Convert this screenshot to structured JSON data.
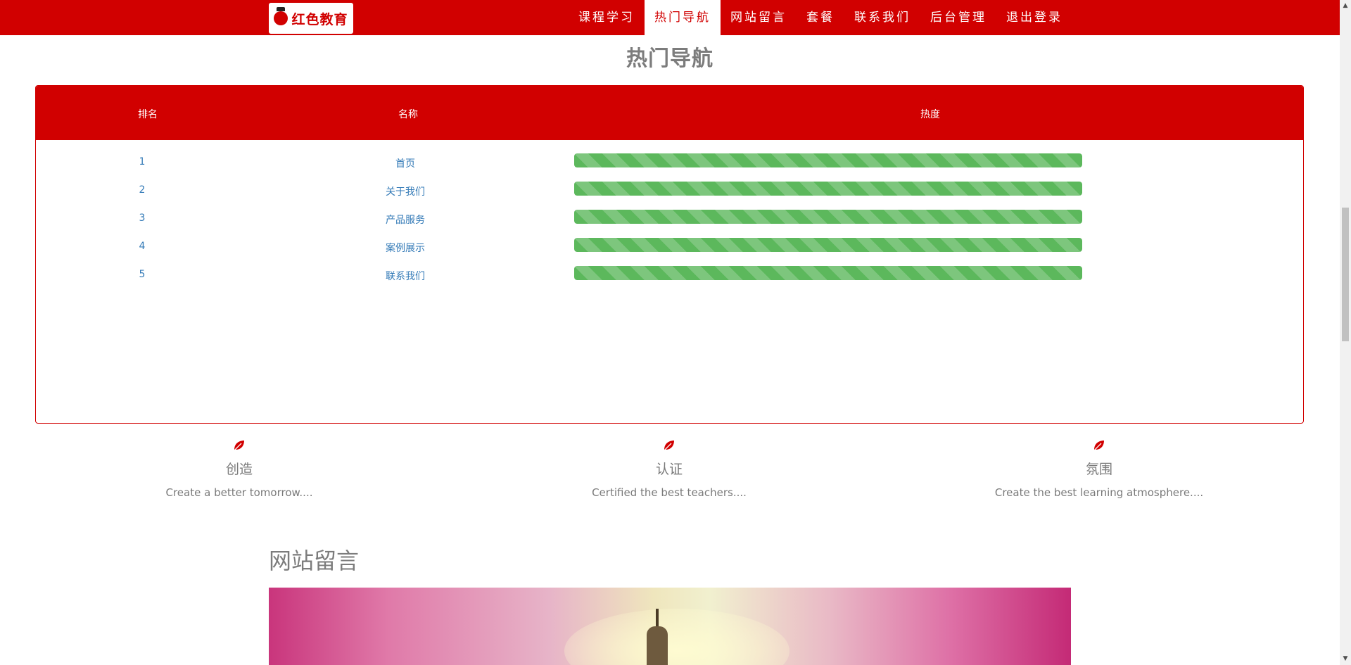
{
  "brand": {
    "logo_text": "红色教育"
  },
  "nav": {
    "items": [
      {
        "label": "课程学习",
        "active": false
      },
      {
        "label": "热门导航",
        "active": true
      },
      {
        "label": "网站留言",
        "active": false
      },
      {
        "label": "套餐",
        "active": false
      },
      {
        "label": "联系我们",
        "active": false
      },
      {
        "label": "后台管理",
        "active": false
      },
      {
        "label": "退出登录",
        "active": false
      }
    ]
  },
  "hot": {
    "title": "热门导航",
    "columns": {
      "rank": "排名",
      "name": "名称",
      "heat": "热度"
    },
    "rows": [
      {
        "rank": "1",
        "name": "首页",
        "heat": 100
      },
      {
        "rank": "2",
        "name": "关于我们",
        "heat": 100
      },
      {
        "rank": "3",
        "name": "产品服务",
        "heat": 100
      },
      {
        "rank": "4",
        "name": "案例展示",
        "heat": 100
      },
      {
        "rank": "5",
        "name": "联系我们",
        "heat": 100
      }
    ]
  },
  "features": [
    {
      "icon": "leaf-icon",
      "title": "创造",
      "desc": "Create a better tomorrow...."
    },
    {
      "icon": "leaf-icon",
      "title": "认证",
      "desc": "Certified the best teachers...."
    },
    {
      "icon": "leaf-icon",
      "title": "氛围",
      "desc": "Create the best learning atmosphere...."
    }
  ],
  "messages": {
    "title": "网站留言"
  },
  "colors": {
    "brand_red": "#d10000",
    "progress_green": "#5cb85c",
    "link_blue": "#337ab7",
    "muted_text": "#7a7a7a"
  }
}
